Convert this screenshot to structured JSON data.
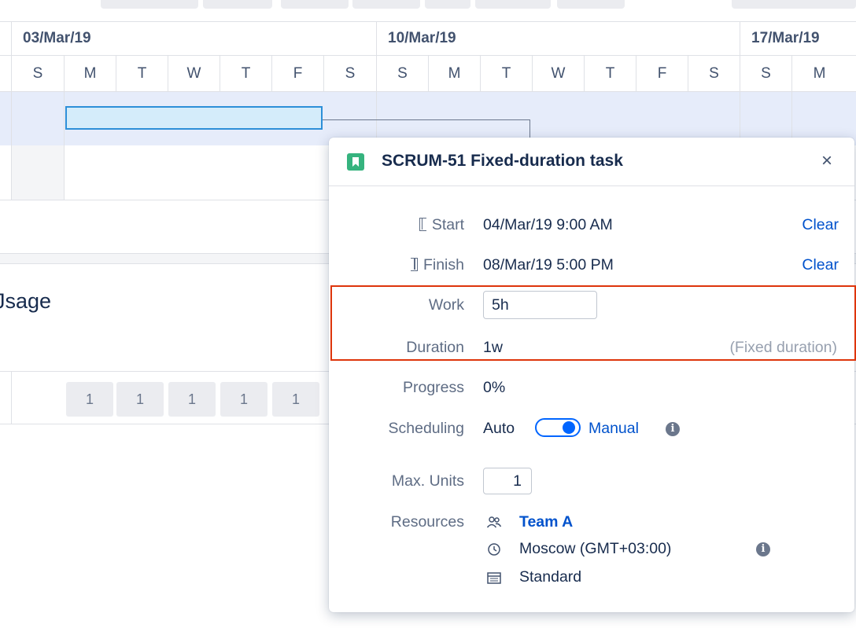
{
  "gantt": {
    "weeks": [
      "03/Mar/19",
      "10/Mar/19",
      "17/Mar/19"
    ],
    "days": [
      "S",
      "M",
      "T",
      "W",
      "T",
      "F",
      "S",
      "S",
      "M",
      "T",
      "W",
      "T",
      "F",
      "S",
      "S",
      "M"
    ]
  },
  "usage": {
    "title": "Jsage",
    "values": [
      "1",
      "1",
      "1",
      "1",
      "1"
    ]
  },
  "popup": {
    "icon": "bookmark-icon",
    "title": "SCRUM-51 Fixed-duration task",
    "close_label": "×",
    "start_label": "Start",
    "start_value": "04/Mar/19 9:00 AM",
    "start_clear": "Clear",
    "finish_label": "Finish",
    "finish_value": "08/Mar/19 5:00 PM",
    "finish_clear": "Clear",
    "work_label": "Work",
    "work_value": "5h",
    "duration_label": "Duration",
    "duration_value": "1w",
    "duration_note": "(Fixed duration)",
    "progress_label": "Progress",
    "progress_value": "0%",
    "scheduling_label": "Scheduling",
    "scheduling_auto": "Auto",
    "scheduling_manual": "Manual",
    "max_units_label": "Max. Units",
    "max_units_value": "1",
    "resources_label": "Resources",
    "resource_team": "Team A",
    "resource_timezone": "Moscow (GMT+03:00)",
    "resource_calendar": "Standard"
  },
  "colors": {
    "accent": "#0052cc",
    "bar_border": "#2d8fd8",
    "highlight": "#de350b",
    "story": "#36b37e"
  }
}
